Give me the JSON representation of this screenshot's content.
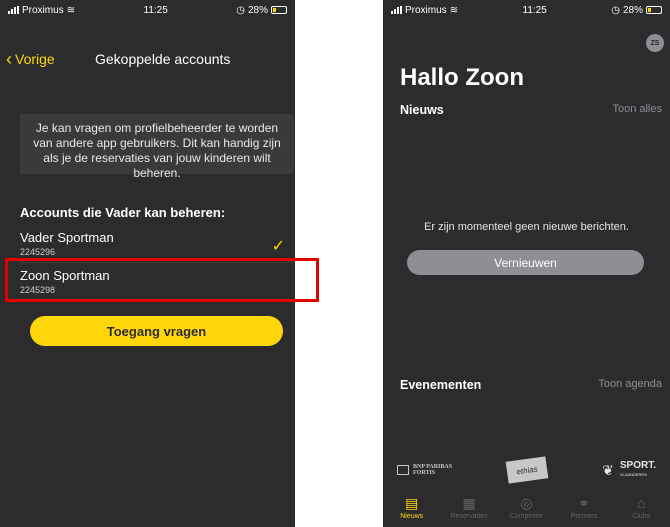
{
  "left_phone": {
    "status": {
      "carrier": "Proximus",
      "time": "11:25",
      "battery": "28%"
    },
    "nav": {
      "back_label": "Vorige",
      "title": "Gekoppelde accounts"
    },
    "info_text": "Je kan vragen om profielbeheerder te worden van andere app gebruikers. Dit kan handig zijn als je de reservaties van jouw kinderen wilt beheren.",
    "section_title": "Accounts die Vader kan beheren:",
    "accounts": [
      {
        "name": "Vader Sportman",
        "id": "2245296",
        "checked": true
      },
      {
        "name": "Zoon Sportman",
        "id": "2245298",
        "checked": false
      }
    ],
    "request_button": "Toegang vragen"
  },
  "right_phone": {
    "status": {
      "carrier": "Proximus",
      "time": "11:25",
      "battery": "28%"
    },
    "avatar_initials": "ZS",
    "greeting": "Hallo Zoon",
    "news": {
      "title": "Nieuws",
      "link": "Toon alles",
      "empty_text": "Er zijn momenteel geen nieuwe berichten.",
      "refresh_button": "Vernieuwen"
    },
    "events": {
      "title": "Evenementen",
      "link": "Toon agenda"
    },
    "sponsors": {
      "bnp_line1": "BNP PARIBAS",
      "bnp_line2": "FORTIS",
      "ethias": "ethias",
      "sport_line1": "SPORT.",
      "sport_line2": "VLAANDEREN"
    },
    "tabs": [
      {
        "label": "Nieuws",
        "icon": "news-icon",
        "active": true
      },
      {
        "label": "Reservaties",
        "icon": "calendar-icon",
        "active": false
      },
      {
        "label": "Competitie",
        "icon": "ball-icon",
        "active": false
      },
      {
        "label": "Partners",
        "icon": "handshake-icon",
        "active": false
      },
      {
        "label": "Clubs",
        "icon": "clubs-icon",
        "active": false
      }
    ]
  },
  "colors": {
    "accent": "#ffd60a",
    "background": "#2c2c2e",
    "highlight": "#e00000"
  }
}
